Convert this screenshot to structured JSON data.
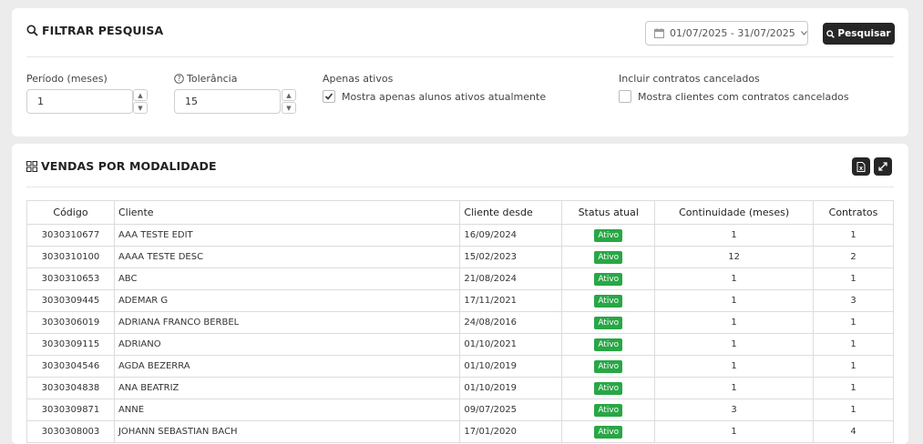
{
  "filter": {
    "title": "FILTRAR PESQUISA",
    "date_range": "01/07/2025 - 31/07/2025",
    "search_button": "Pesquisar",
    "periodo_label": "Período (meses)",
    "periodo_value": "1",
    "tolerancia_label": "Tolerância",
    "tolerancia_value": "15",
    "apenas_ativos_label": "Apenas ativos",
    "apenas_ativos_text": "Mostra apenas alunos ativos atualmente",
    "apenas_ativos_checked": true,
    "cancelados_label": "Incluir contratos cancelados",
    "cancelados_text": "Mostra clientes com contratos cancelados",
    "cancelados_checked": false
  },
  "vendas": {
    "title": "VENDAS POR MODALIDADE",
    "columns": [
      "Código",
      "Cliente",
      "Cliente desde",
      "Status atual",
      "Continuidade (meses)",
      "Contratos"
    ],
    "rows": [
      {
        "codigo": "3030310677",
        "cliente": "AAA TESTE EDIT",
        "desde": "16/09/2024",
        "status": "Ativo",
        "continuidade": "1",
        "contratos": "1"
      },
      {
        "codigo": "3030310100",
        "cliente": "AAAA TESTE DESC",
        "desde": "15/02/2023",
        "status": "Ativo",
        "continuidade": "12",
        "contratos": "2"
      },
      {
        "codigo": "3030310653",
        "cliente": "ABC",
        "desde": "21/08/2024",
        "status": "Ativo",
        "continuidade": "1",
        "contratos": "1"
      },
      {
        "codigo": "3030309445",
        "cliente": "ADEMAR G",
        "desde": "17/11/2021",
        "status": "Ativo",
        "continuidade": "1",
        "contratos": "3"
      },
      {
        "codigo": "3030306019",
        "cliente": "ADRIANA FRANCO BERBEL",
        "desde": "24/08/2016",
        "status": "Ativo",
        "continuidade": "1",
        "contratos": "1"
      },
      {
        "codigo": "3030309115",
        "cliente": "ADRIANO",
        "desde": "01/10/2021",
        "status": "Ativo",
        "continuidade": "1",
        "contratos": "1"
      },
      {
        "codigo": "3030304546",
        "cliente": "AGDA BEZERRA",
        "desde": "01/10/2019",
        "status": "Ativo",
        "continuidade": "1",
        "contratos": "1"
      },
      {
        "codigo": "3030304838",
        "cliente": "ANA BEATRIZ",
        "desde": "01/10/2019",
        "status": "Ativo",
        "continuidade": "1",
        "contratos": "1"
      },
      {
        "codigo": "3030309871",
        "cliente": "ANNE",
        "desde": "09/07/2025",
        "status": "Ativo",
        "continuidade": "3",
        "contratos": "1"
      },
      {
        "codigo": "3030308003",
        "cliente": "JOHANN SEBASTIAN BACH",
        "desde": "17/01/2020",
        "status": "Ativo",
        "continuidade": "1",
        "contratos": "4"
      }
    ]
  },
  "icons": {
    "search": "search-icon",
    "calendar": "calendar-icon",
    "chevron": "chevron-down-icon",
    "help": "help-icon",
    "grid": "grid-icon",
    "excel": "excel-export-icon",
    "expand": "expand-icon"
  },
  "colors": {
    "dark_button": "#262626",
    "status_active": "#28a745",
    "background": "#ececec"
  }
}
